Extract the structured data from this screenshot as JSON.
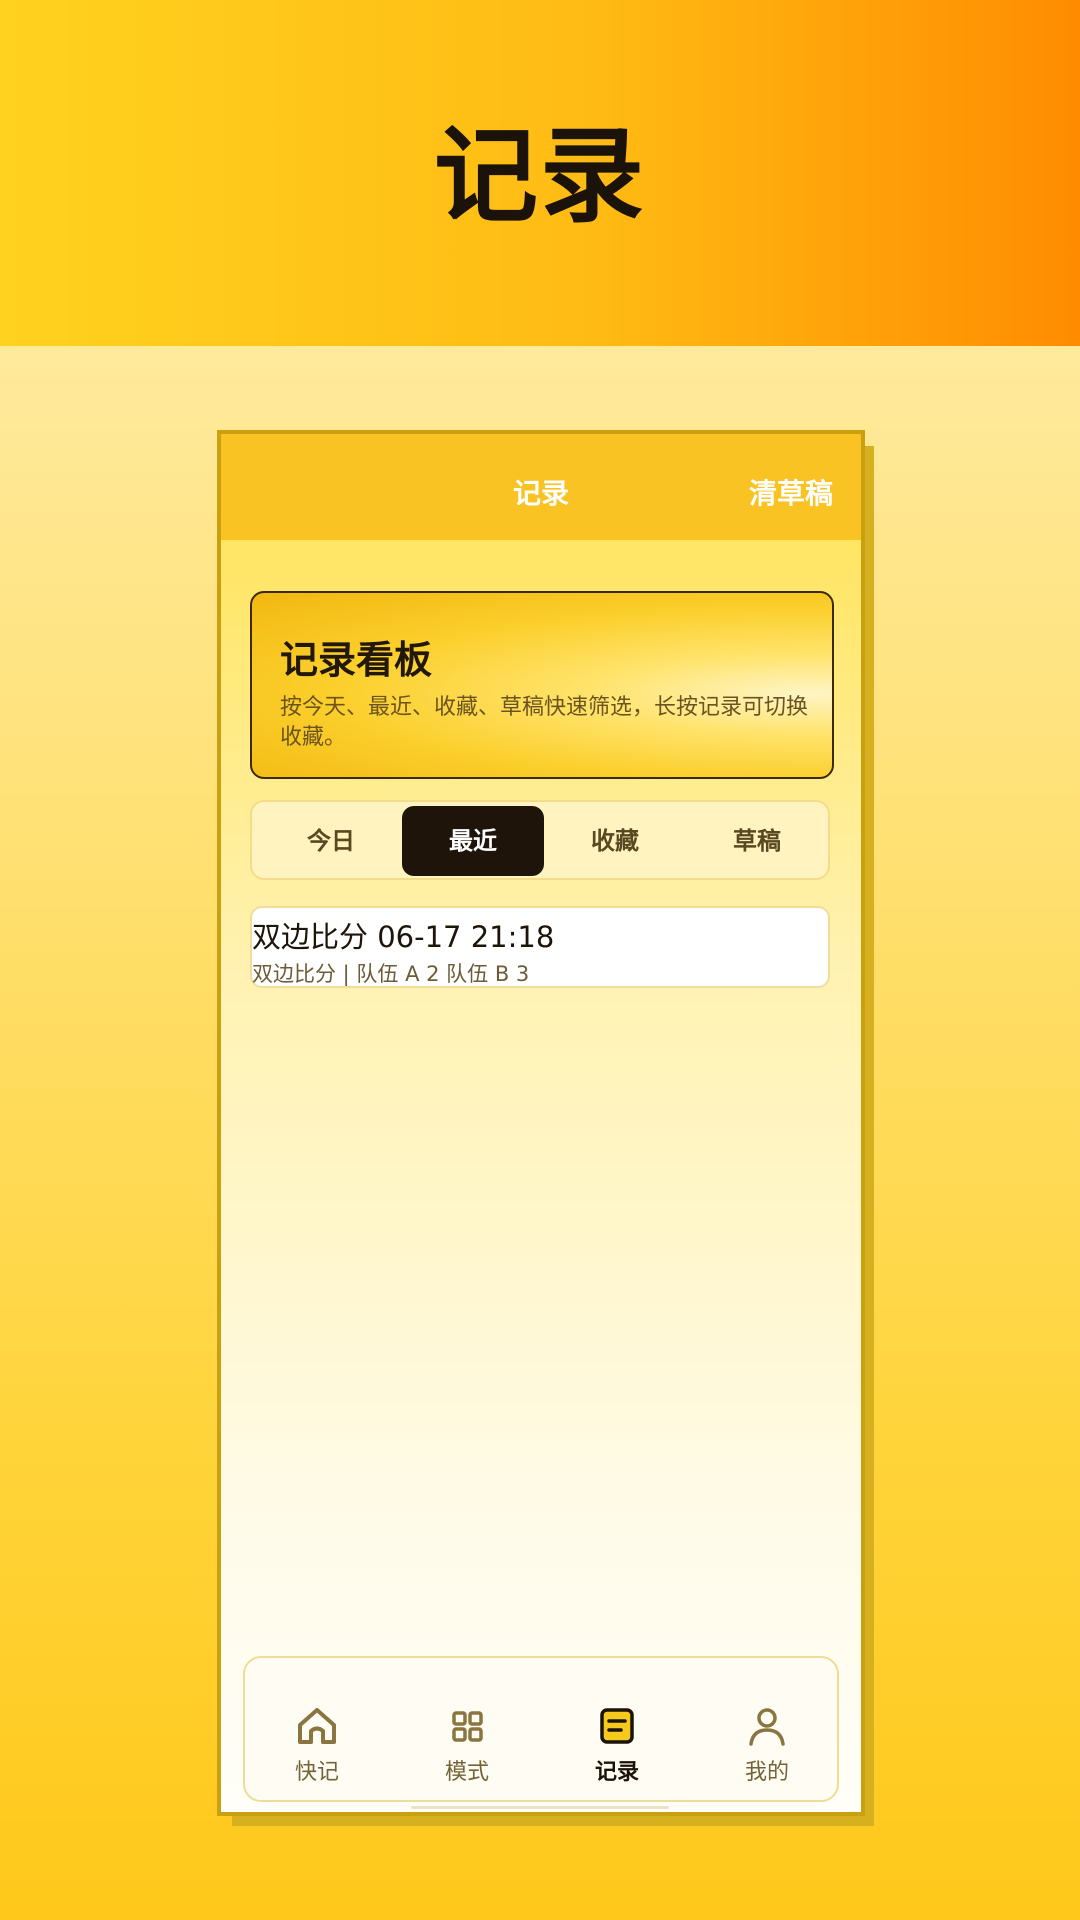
{
  "banner": {
    "title": "记录"
  },
  "appbar": {
    "title": "记录",
    "action": "清草稿"
  },
  "board": {
    "title": "记录看板",
    "description": "按今天、最近、收藏、草稿快速筛选，长按记录可切换收藏。"
  },
  "filters": {
    "items": [
      {
        "label": "今日"
      },
      {
        "label": "最近"
      },
      {
        "label": "收藏"
      },
      {
        "label": "草稿"
      }
    ],
    "selected": "最近"
  },
  "records": [
    {
      "title": "双边比分 06-17 21:18",
      "subtitle": "双边比分 | 队伍 A 2  队伍 B 3"
    }
  ],
  "bottom_nav": {
    "items": [
      {
        "label": "快记",
        "icon": "home-icon"
      },
      {
        "label": "模式",
        "icon": "grid-icon"
      },
      {
        "label": "记录",
        "icon": "note-icon"
      },
      {
        "label": "我的",
        "icon": "person-icon"
      }
    ],
    "active": "记录"
  },
  "colors": {
    "accent": "#ffc81a",
    "appbar": "#f8c323",
    "selected_segment": "#1e140a",
    "active_icon": "#f6c91f",
    "inactive_icon": "#8a7540"
  }
}
